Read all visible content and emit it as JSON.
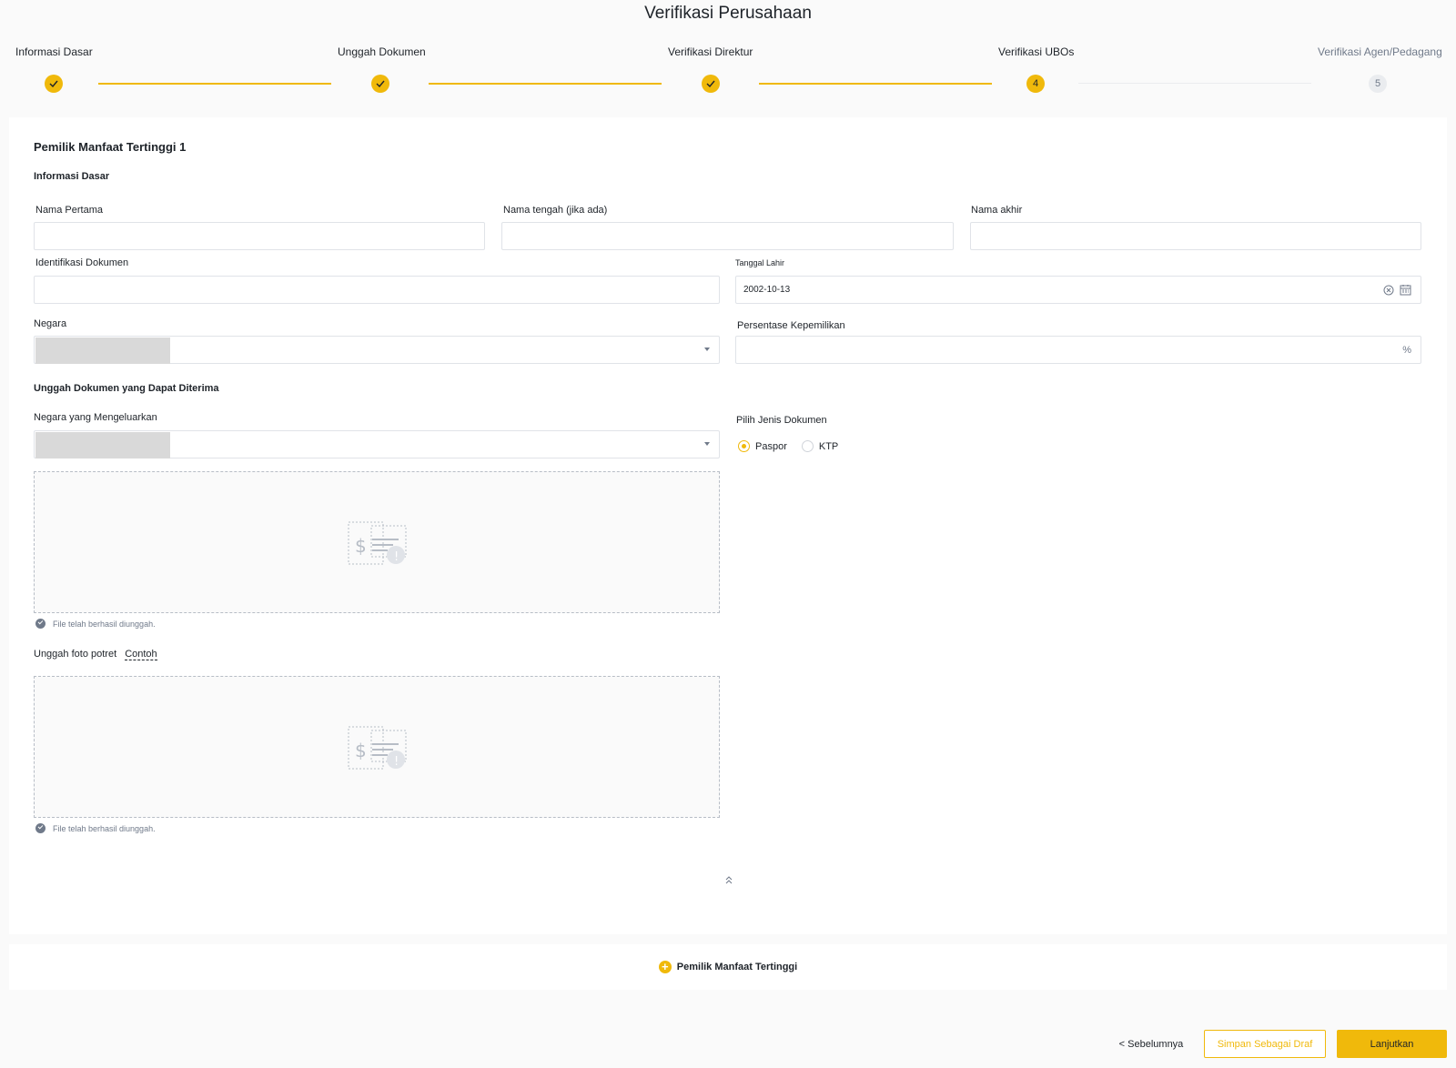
{
  "page": {
    "title": "Verifikasi Perusahaan"
  },
  "steps": [
    {
      "label": "Informasi Dasar",
      "status": "done",
      "number": "1"
    },
    {
      "label": "Unggah Dokumen",
      "status": "done",
      "number": "2"
    },
    {
      "label": "Verifikasi Direktur",
      "status": "done",
      "number": "3"
    },
    {
      "label": "Verifikasi UBOs",
      "status": "current",
      "number": "4"
    },
    {
      "label": "Verifikasi Agen/Pedagang",
      "status": "pending",
      "number": "5"
    }
  ],
  "ubo": {
    "title": "Pemilik Manfaat Tertinggi 1",
    "basic_info_title": "Informasi Dasar",
    "first_name": {
      "label": "Nama Pertama",
      "value": ""
    },
    "middle_name": {
      "label": "Nama tengah (jika ada)",
      "value": ""
    },
    "last_name": {
      "label": "Nama akhir",
      "value": ""
    },
    "id_document": {
      "label": "Identifikasi Dokumen",
      "value": ""
    },
    "birth_date": {
      "label": "Tanggal Lahir",
      "value": "2002-10-13"
    },
    "country": {
      "label": "Negara",
      "value": ""
    },
    "ownership": {
      "label": "Persentase Kepemilikan",
      "value": "",
      "suffix": "%"
    },
    "upload_section_title": "Unggah Dokumen yang Dapat Diterima",
    "issuing_country": {
      "label": "Negara yang Mengeluarkan",
      "value": ""
    },
    "doc_type": {
      "label": "Pilih Jenis Dokumen",
      "options": [
        "Paspor",
        "KTP"
      ],
      "selected": "Paspor"
    },
    "upload_success_1": "File telah berhasil diunggah.",
    "portrait_label": "Unggah foto potret",
    "portrait_example": "Contoh",
    "upload_success_2": "File telah berhasil diunggah."
  },
  "add_ubo_label": "Pemilik Manfaat Tertinggi",
  "footer": {
    "prev_label": "< Sebelumnya",
    "draft_label": "Simpan Sebagai Draf",
    "next_label": "Lanjutkan"
  },
  "colors": {
    "accent": "#f0b90b",
    "border": "#e0e3e8",
    "muted": "#707a8a"
  },
  "icons": [
    "check-icon",
    "clear-icon",
    "calendar-icon",
    "chevron-down-icon",
    "document-placeholder-icon",
    "success-check-icon",
    "collapse-up-icon",
    "plus-icon"
  ]
}
